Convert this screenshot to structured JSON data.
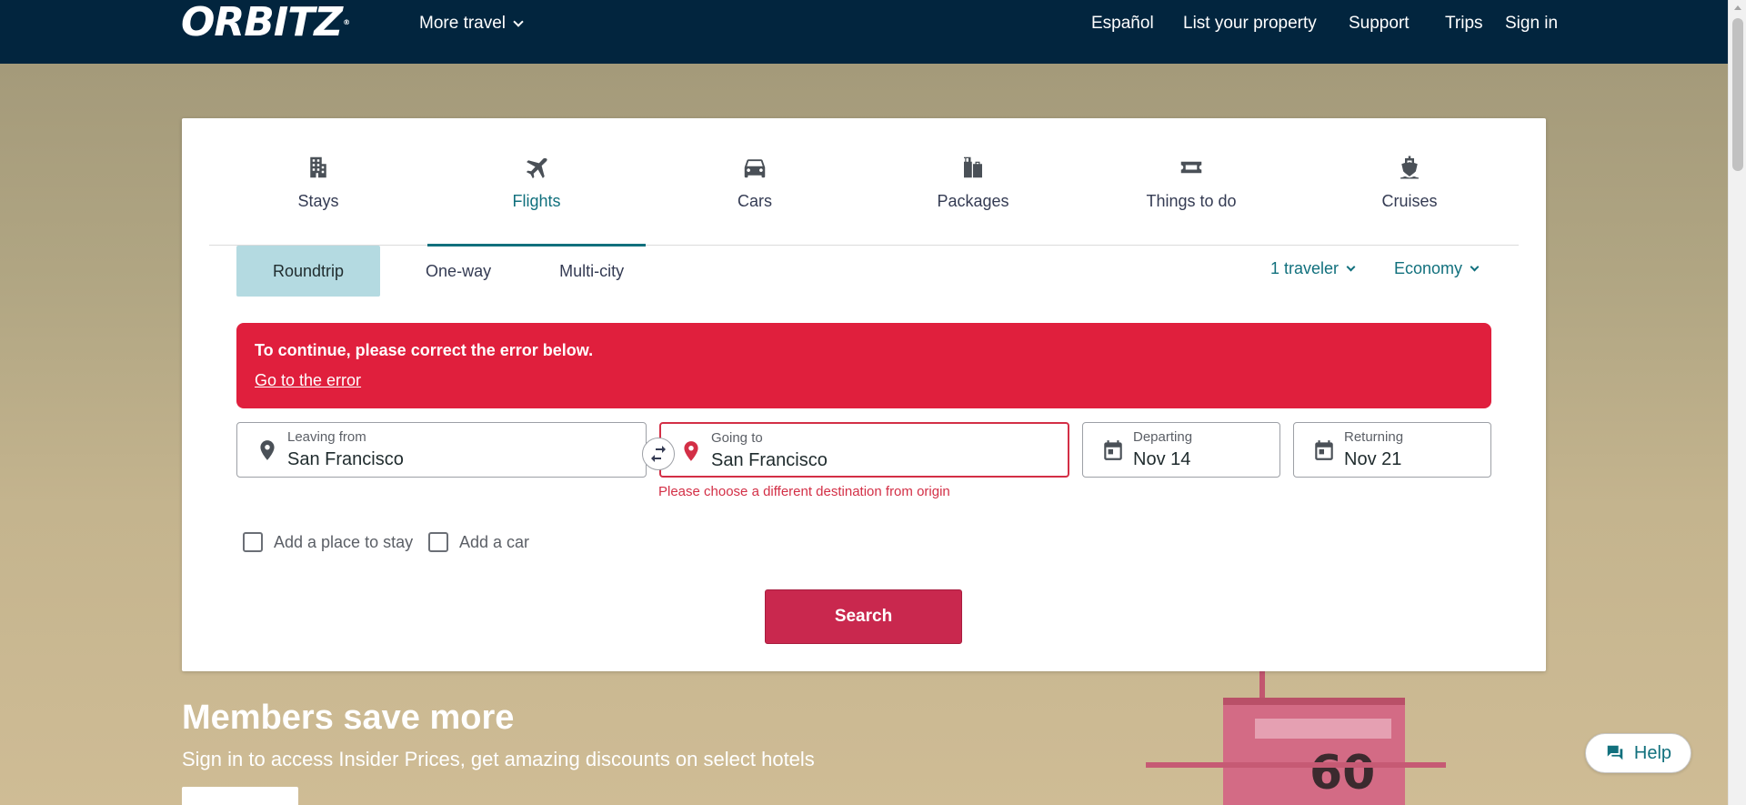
{
  "header": {
    "logo": "ORBITZ",
    "logo_mark": "®",
    "more_travel": "More travel",
    "nav": [
      "Español",
      "List your property",
      "Support",
      "Trips",
      "Sign in"
    ]
  },
  "tabs": [
    {
      "label": "Stays",
      "icon": "building-icon"
    },
    {
      "label": "Flights",
      "icon": "airplane-icon"
    },
    {
      "label": "Cars",
      "icon": "car-icon"
    },
    {
      "label": "Packages",
      "icon": "luggage-icon"
    },
    {
      "label": "Things to do",
      "icon": "ticket-icon"
    },
    {
      "label": "Cruises",
      "icon": "ship-icon"
    }
  ],
  "active_tab": "Flights",
  "trip_types": [
    "Roundtrip",
    "One-way",
    "Multi-city"
  ],
  "active_trip_type": "Roundtrip",
  "travelers": "1 traveler",
  "cabin_class": "Economy",
  "error": {
    "title": "To continue, please correct the error below.",
    "link": "Go to the error"
  },
  "fields": {
    "leaving_from": {
      "label": "Leaving from",
      "value": "San Francisco"
    },
    "going_to": {
      "label": "Going to",
      "value": "San Francisco",
      "error": "Please choose a different destination from origin"
    },
    "departing": {
      "label": "Departing",
      "value": "Nov 14"
    },
    "returning": {
      "label": "Returning",
      "value": "Nov 21"
    }
  },
  "addons": [
    "Add a place to stay",
    "Add a car"
  ],
  "search_label": "Search",
  "members": {
    "title": "Members save more",
    "subtitle": "Sign in to access Insider Prices, get amazing discounts on select hotels"
  },
  "hero_image_number": "60",
  "help_label": "Help",
  "colors": {
    "header_bg": "#02253e",
    "accent_teal": "#11707d",
    "error_red": "#e01f3d",
    "search_button": "#c9284e",
    "roundtrip_active": "#b4dae1"
  }
}
